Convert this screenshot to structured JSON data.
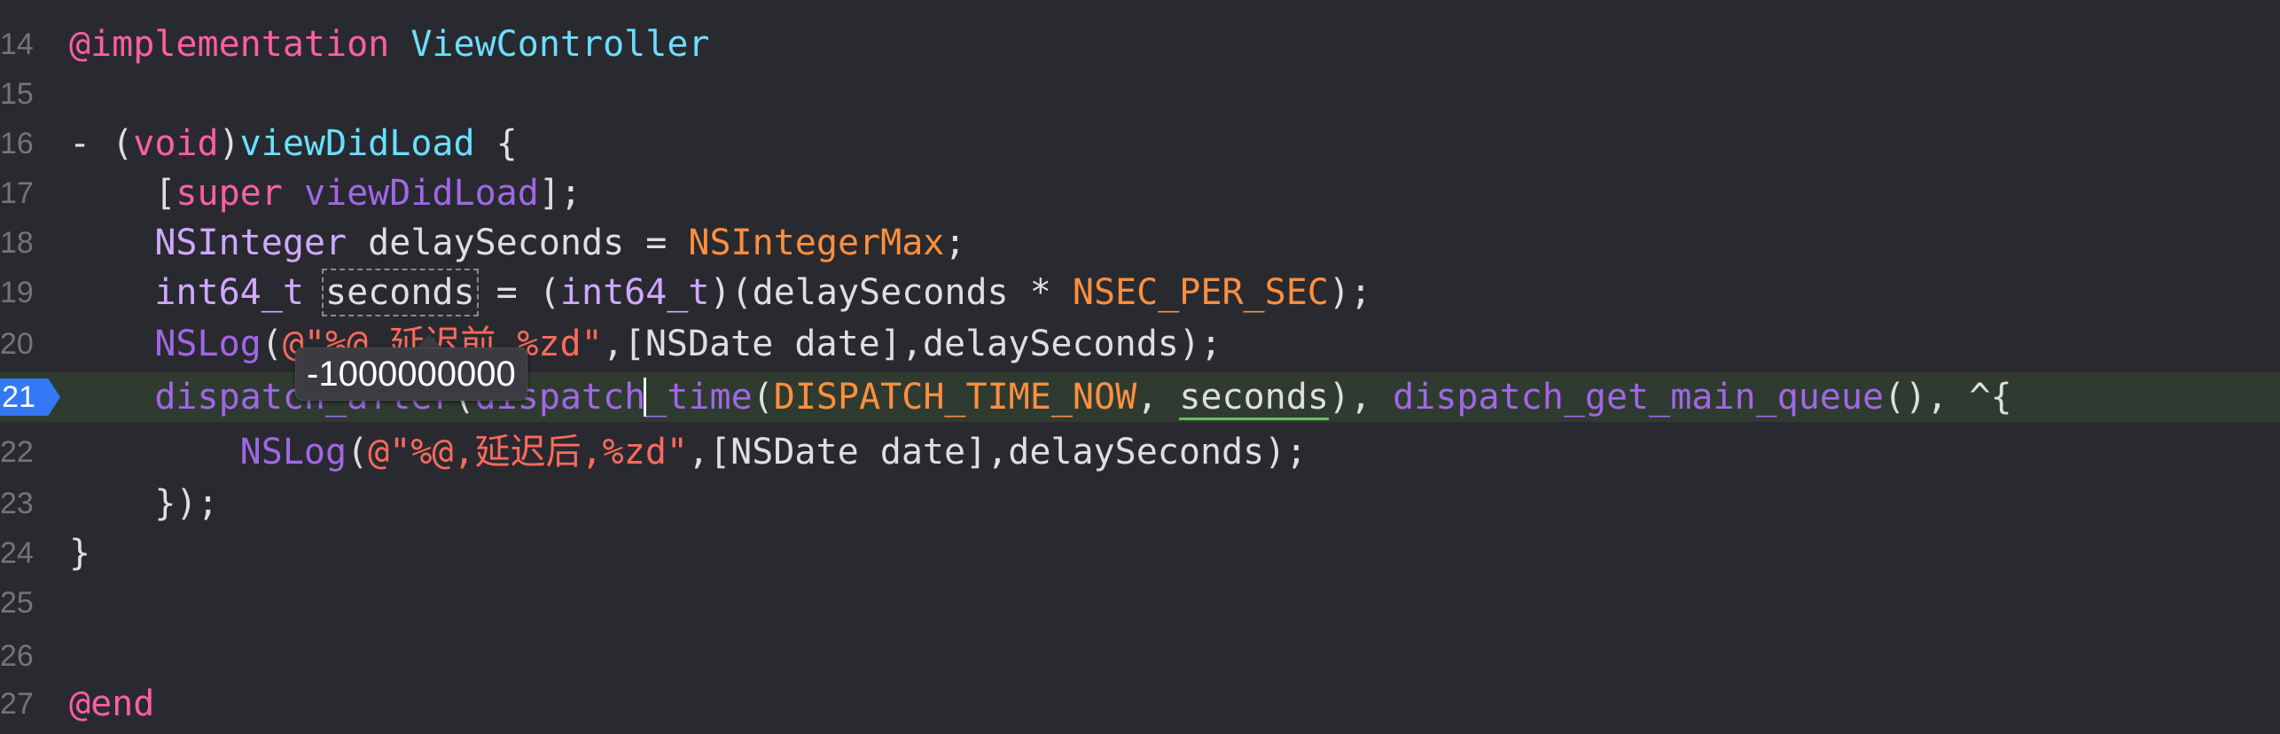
{
  "line_numbers": [
    "14",
    "15",
    "16",
    "17",
    "18",
    "19",
    "20",
    "21",
    "22",
    "23",
    "24",
    "25",
    "26",
    "27"
  ],
  "breakpoint_line": "21",
  "tooltip": {
    "value": "-1000000000"
  },
  "code": {
    "l14": {
      "kw": "@implementation",
      "cls": "ViewController"
    },
    "l16": {
      "dash": "- (",
      "void": "void",
      "close": ")",
      "name": "viewDidLoad",
      "brace": " {"
    },
    "l17": {
      "open": "[",
      "super": "super",
      "sel": "viewDidLoad",
      "end": "];"
    },
    "l18": {
      "type": "NSInteger",
      "rest": " delaySeconds = ",
      "const": "NSIntegerMax",
      "end": ";"
    },
    "l19": {
      "type": "int64_t",
      "sp": " ",
      "var": "seconds",
      "eq": " = (",
      "type2": "int64_t",
      "mid": ")(delaySeconds * ",
      "const": "NSEC_PER_SEC",
      "end": ");"
    },
    "l20": {
      "func": "NSLog",
      "open": "(",
      "str": "@\"%@,延迟前,%zd\"",
      "rest": ",[NSDate date],delaySeconds);"
    },
    "l21": {
      "f1": "dispatch_after",
      "p1": "(",
      "f2": "dispatch_time",
      "p2": "(",
      "c1": "DISPATCH_TIME_NOW",
      "comma": ", ",
      "var": "seconds",
      "p3": "), ",
      "f3": "dispatch_get_main_queue",
      "tail": "(), ^{"
    },
    "l22": {
      "func": "NSLog",
      "open": "(",
      "str": "@\"%@,延迟后,%zd\"",
      "rest": ",[NSDate date],delaySeconds);"
    },
    "l23": {
      "text": "});"
    },
    "l24": {
      "text": "}"
    },
    "l27": {
      "kw": "@end"
    }
  },
  "colors": {
    "background": "#292a30",
    "current_line": "#2f3b30",
    "keyword": "#fc5fa3",
    "type": "#d0a8ff",
    "string": "#fc6a5d",
    "constant": "#fd8f3f",
    "declaration": "#6bdfff",
    "breakpoint": "#3478f6"
  }
}
